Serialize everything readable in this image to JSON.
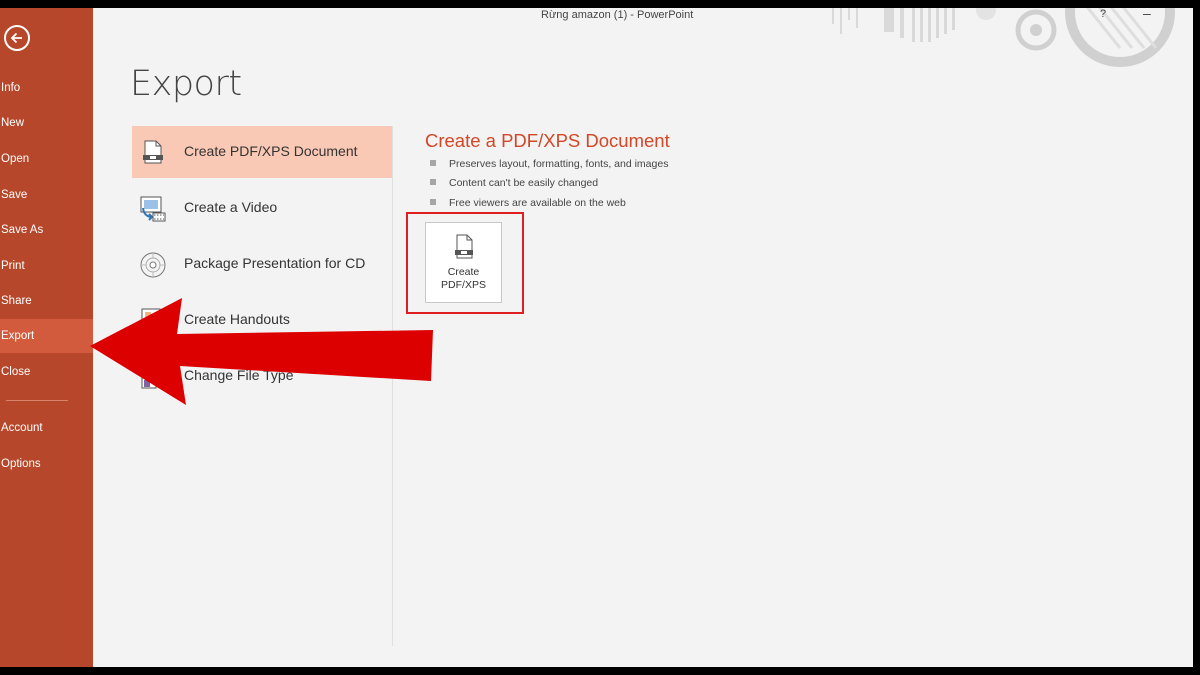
{
  "window": {
    "title": "Rừng amazon (1) - PowerPoint",
    "help_label": "?",
    "minimize_label": "–"
  },
  "sidebar": {
    "items": [
      {
        "label": "Info"
      },
      {
        "label": "New"
      },
      {
        "label": "Open"
      },
      {
        "label": "Save"
      },
      {
        "label": "Save As"
      },
      {
        "label": "Print"
      },
      {
        "label": "Share"
      },
      {
        "label": "Export",
        "active": true
      },
      {
        "label": "Close"
      },
      {
        "label": "Account"
      },
      {
        "label": "Options"
      }
    ]
  },
  "page": {
    "title": "Export"
  },
  "options": [
    {
      "label": "Create PDF/XPS Document",
      "icon": "pdf-document-icon",
      "active": true
    },
    {
      "label": "Create a Video",
      "icon": "video-icon"
    },
    {
      "label": "Package Presentation for CD",
      "icon": "cd-icon"
    },
    {
      "label": "Create Handouts",
      "icon": "handouts-icon"
    },
    {
      "label": "Change File Type",
      "icon": "file-type-icon"
    }
  ],
  "detail": {
    "title": "Create a PDF/XPS Document",
    "bullets": [
      "Preserves layout, formatting, fonts, and images",
      "Content can't be easily changed",
      "Free viewers are available on the web"
    ],
    "button_line1": "Create",
    "button_line2": "PDF/XPS"
  },
  "colors": {
    "sidebar": "#b7472a",
    "sidebar_active": "#d15b3c",
    "option_active": "#f9c9b5",
    "accent": "#d24726",
    "annotation": "#e02020"
  }
}
